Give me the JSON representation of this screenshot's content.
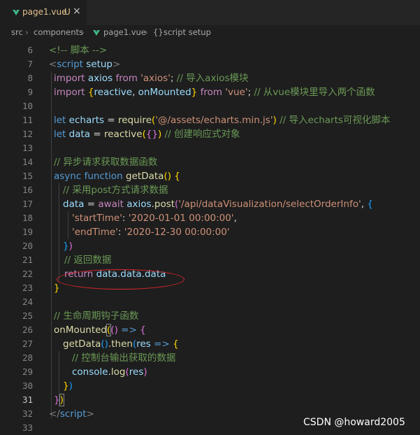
{
  "tab": {
    "label": "page1.vue",
    "badge": "U",
    "close": "×"
  },
  "breadcrumb": {
    "segments": [
      "src",
      "components",
      "page1.vue",
      "script setup"
    ],
    "sep": "›",
    "braces": "{}"
  },
  "line_numbers": [
    "6",
    "7",
    "8",
    "9",
    "10",
    "11",
    "12",
    "13",
    "14",
    "15",
    "16",
    "17",
    "18",
    "19",
    "20",
    "21",
    "22",
    "23",
    "24",
    "25",
    "26",
    "27",
    "28",
    "29",
    "30",
    "31",
    "32",
    "33"
  ],
  "active_line": "31",
  "code": {
    "l6": {
      "comment": "<!-- 脚本 -->"
    },
    "l7": {
      "lt": "<",
      "tag": "script",
      "attr": "setup",
      "gt": ">"
    },
    "l8": {
      "kw1": "import",
      "id": "axios",
      "kw2": "from",
      "str": "'axios'",
      "semi": ";",
      "comment": "// 导入axios模块"
    },
    "l9": {
      "kw1": "import",
      "ob": "{",
      "id1": "reactive",
      "comma": ",",
      "id2": "onMounted",
      "cb": "}",
      "kw2": "from",
      "str": "'vue'",
      "semi": ";",
      "comment": "// 从vue模块里导入两个函数"
    },
    "l11": {
      "kw": "let",
      "id": "echarts",
      "eq": "=",
      "fn": "require",
      "op": "(",
      "str": "'@/assets/echarts.min.js'",
      "cp": ")",
      "comment": "// 导入echarts可视化脚本"
    },
    "l12": {
      "kw": "let",
      "id": "data",
      "eq": "=",
      "fn": "reactive",
      "op": "(",
      "ob": "{",
      "cb": "}",
      "cp": ")",
      "comment": "// 创建响应式对象"
    },
    "l14": {
      "comment": "// 异步请求获取数据函数"
    },
    "l15": {
      "kw1": "async",
      "kw2": "function",
      "fn": "getData",
      "parens": "()",
      "ob": "{"
    },
    "l16": {
      "comment": "// 采用post方式请求数据"
    },
    "l17": {
      "id": "data",
      "eq": "=",
      "kw": "await",
      "obj": "axios",
      "dot": ".",
      "fn": "post",
      "op": "(",
      "str": "'/api/dataVisualization/selectOrderInfo'",
      "comma": ",",
      "ob": "{"
    },
    "l18": {
      "key": "'startTime'",
      "colon": ":",
      "val": "'2020-01-01 00:00:00'",
      "comma": ","
    },
    "l19": {
      "key": "'endTime'",
      "colon": ":",
      "val": "'2020-12-30 00:00:00'"
    },
    "l20": {
      "cb": "}",
      "cp": ")"
    },
    "l21": {
      "comment": "// 返回数据"
    },
    "l22": {
      "kw": "return",
      "expr": "data.data.data"
    },
    "l23": {
      "cb": "}"
    },
    "l25": {
      "comment": "// 生命周期钩子函数"
    },
    "l26": {
      "fn": "onMounted",
      "op": "(",
      "parens": "()",
      "arrow": "=>",
      "ob": "{"
    },
    "l27": {
      "fn1": "getData",
      "parens": "()",
      "dot": ".",
      "fn2": "then",
      "op": "(",
      "param": "res",
      "arrow": "=>",
      "ob": "{"
    },
    "l28": {
      "comment": "// 控制台输出获取的数据"
    },
    "l29": {
      "obj": "console",
      "dot": ".",
      "fn": "log",
      "op": "(",
      "arg": "res",
      "cp": ")"
    },
    "l30": {
      "cb": "}",
      "cp": ")"
    },
    "l31": {
      "cb": "}",
      "cp": ")"
    },
    "l32": {
      "lt": "</",
      "tag": "script",
      "gt": ">"
    }
  },
  "watermark": "CSDN @howard2005",
  "colors": {
    "accent_vue": "#41b883",
    "untracked": "#e2c08d",
    "annotation": "#e0262b"
  }
}
